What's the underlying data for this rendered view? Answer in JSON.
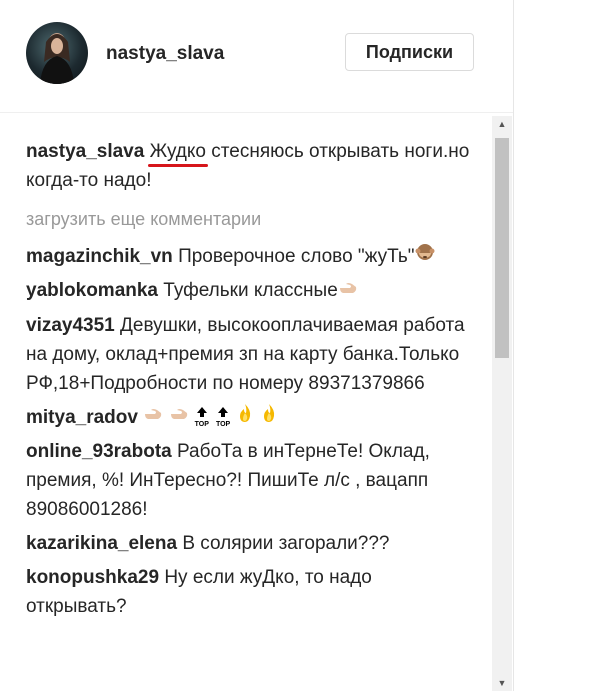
{
  "post": {
    "username": "nastya_slava",
    "follow_button": "Подписки",
    "caption": {
      "user": "nastya_slava",
      "underlined_word": "Жудко",
      "text": " стесняюсь открывать ноги.но когда-то надо!"
    },
    "load_more": "загрузить еще комментарии",
    "comments": [
      {
        "user": "magazinchik_vn",
        "text": "Проверочное слово \"жуТь\"",
        "emoji": "see-no-evil-monkey"
      },
      {
        "user": "yablokomanka",
        "text": "Туфельки классные",
        "emoji": "pointing-hand"
      },
      {
        "user": "vizay4351",
        "text": "Девушки, высокооплачиваемая работа на дому, оклад+премия зп на карту банка.Только РФ,18+Подробности по номеру 89371379866"
      },
      {
        "user": "mitya_radov",
        "text": "",
        "emoji": "hands-top-fire"
      },
      {
        "user": "online_93rabota",
        "text": "РабоТа в инТернеТе! Оклад, премия, %! ИнТересно?! ПишиТе л/с , вацапп 89086001286!"
      },
      {
        "user": "kazarikina_elena",
        "text": "В солярии загорали???"
      },
      {
        "user": "konopushka29",
        "text": "Ну если жуДко, то надо открывать?"
      }
    ]
  },
  "colors": {
    "text": "#262626",
    "muted": "#999999",
    "underline": "#d6151b",
    "border": "#dbdbdb"
  }
}
